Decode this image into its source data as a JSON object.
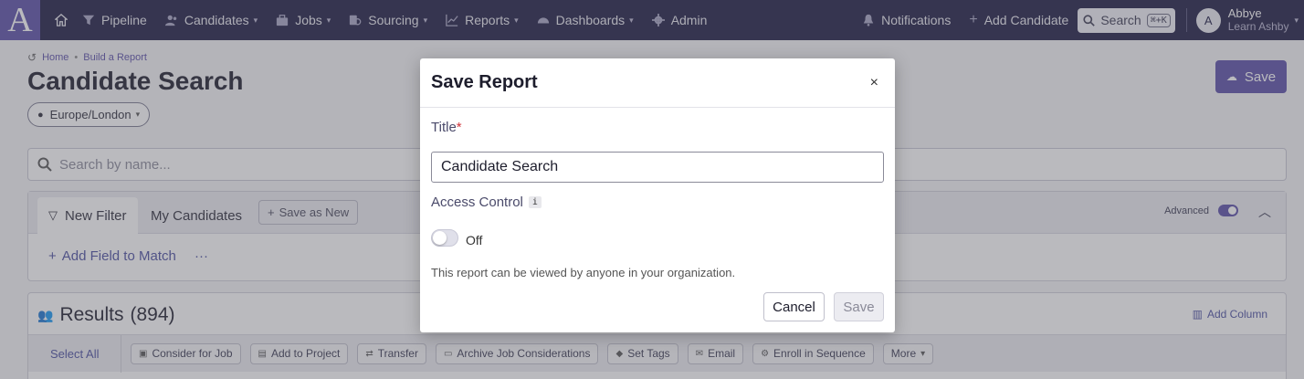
{
  "nav": {
    "logo": "A",
    "items": [
      {
        "label": "Pipeline",
        "icon": "funnel-icon",
        "dropdown": false
      },
      {
        "label": "Candidates",
        "icon": "people-icon",
        "dropdown": true
      },
      {
        "label": "Jobs",
        "icon": "briefcase-icon",
        "dropdown": true
      },
      {
        "label": "Sourcing",
        "icon": "sourcing-icon",
        "dropdown": true
      },
      {
        "label": "Reports",
        "icon": "chart-icon",
        "dropdown": true
      },
      {
        "label": "Dashboards",
        "icon": "gauge-icon",
        "dropdown": true
      },
      {
        "label": "Admin",
        "icon": "gear-icon",
        "dropdown": false
      }
    ],
    "notifications": "Notifications",
    "add_candidate": "Add Candidate",
    "search_label": "Search",
    "search_shortcut": "⌘+K",
    "user": {
      "initial": "A",
      "name": "Abbye",
      "org": "Learn Ashby"
    }
  },
  "breadcrumb": {
    "home": "Home",
    "current": "Build a Report"
  },
  "page": {
    "title": "Candidate Search",
    "timezone": "Europe/London",
    "save_button": "Save",
    "search_placeholder": "Search by name..."
  },
  "filters": {
    "tab_new": "New Filter",
    "tab_mine": "My Candidates",
    "save_as_new": "Save as New",
    "advanced": "Advanced",
    "add_field": "Add Field to Match",
    "more": "···"
  },
  "results": {
    "title": "Results",
    "count": "(894)",
    "add_column": "Add Column",
    "select_all": "Select All",
    "actions": [
      "Consider for Job",
      "Add to Project",
      "Transfer",
      "Archive Job Considerations",
      "Set Tags",
      "Email",
      "Enroll in Sequence",
      "More"
    ]
  },
  "modal": {
    "title": "Save Report",
    "title_label": "Title",
    "required_mark": "*",
    "title_value": "Candidate Search",
    "access_label": "Access Control",
    "info_badge": "i",
    "toggle_state": "Off",
    "help_text": "This report can be viewed by anyone in your organization.",
    "cancel": "Cancel",
    "save": "Save",
    "close": "×"
  },
  "colors": {
    "nav_bg": "#1c1a42",
    "accent": "#5a4fa8",
    "required": "#d0343a"
  }
}
